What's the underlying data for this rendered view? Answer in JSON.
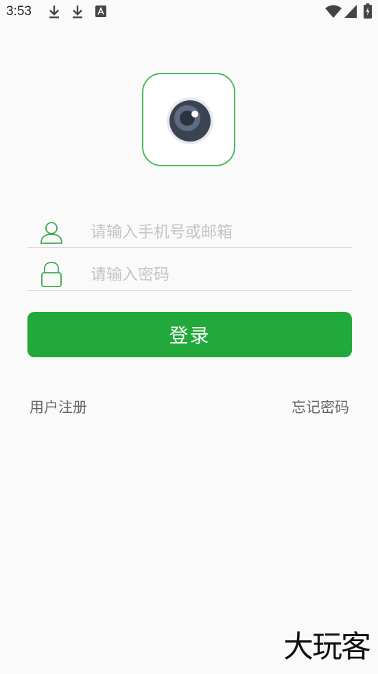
{
  "status_bar": {
    "time": "3:53",
    "icons": [
      "download-icon",
      "download-icon",
      "a-icon",
      "wifi-icon",
      "signal-icon",
      "battery-charging-icon"
    ]
  },
  "app": {
    "logo": "camera-lens-icon",
    "accent_color": "#22a93b",
    "logo_border_color": "#4cb85a"
  },
  "form": {
    "account_placeholder": "请输入手机号或邮箱",
    "account_value": "",
    "password_placeholder": "请输入密码",
    "password_value": "",
    "login_label": "登录"
  },
  "links": {
    "register": "用户注册",
    "forgot_password": "忘记密码"
  },
  "watermark": "大玩客"
}
